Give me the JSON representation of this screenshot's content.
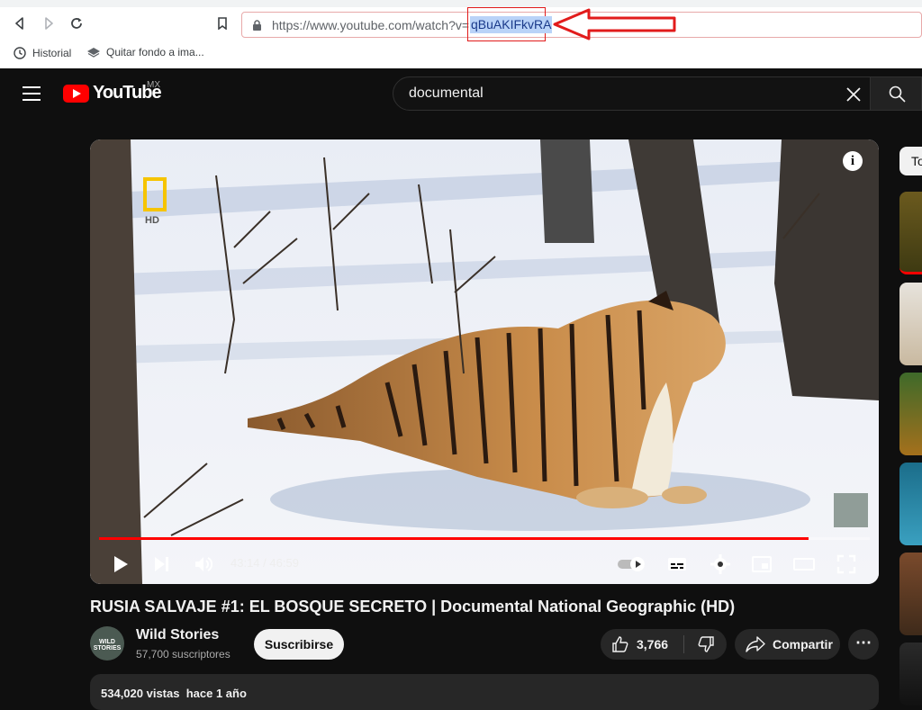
{
  "browser": {
    "url_prefix": "https://www.youtube.com/watch?v=",
    "url_selected": "qBuAKIFkvRA",
    "bookmarks": [
      {
        "label": "Historial",
        "icon": "history-icon"
      },
      {
        "label": "Quitar fondo a ima...",
        "icon": "layers-icon"
      }
    ]
  },
  "header": {
    "logo_text": "YouTube",
    "region": "MX",
    "search_value": "documental"
  },
  "player": {
    "time_current": "43:14",
    "time_total": "46:59",
    "time_separator": " / ",
    "progress_fraction": 0.92,
    "hd_label": "HD",
    "watermark_text": "WILD STORIES",
    "accent_color": "#ff0000"
  },
  "video": {
    "title": "RUSIA SALVAJE #1: EL BOSQUE SECRETO | Documental National Geographic (HD)",
    "channel_name": "Wild Stories",
    "channel_subs": "57,700 suscriptores",
    "channel_avatar_text": "WILD STORIES",
    "subscribe_label": "Suscribirse",
    "like_count": "3,766",
    "share_label": "Compartir",
    "more_label": "⋯",
    "views": "534,020 vistas",
    "published": "hace 1 año"
  },
  "sidebar": {
    "chip_label": "To"
  }
}
